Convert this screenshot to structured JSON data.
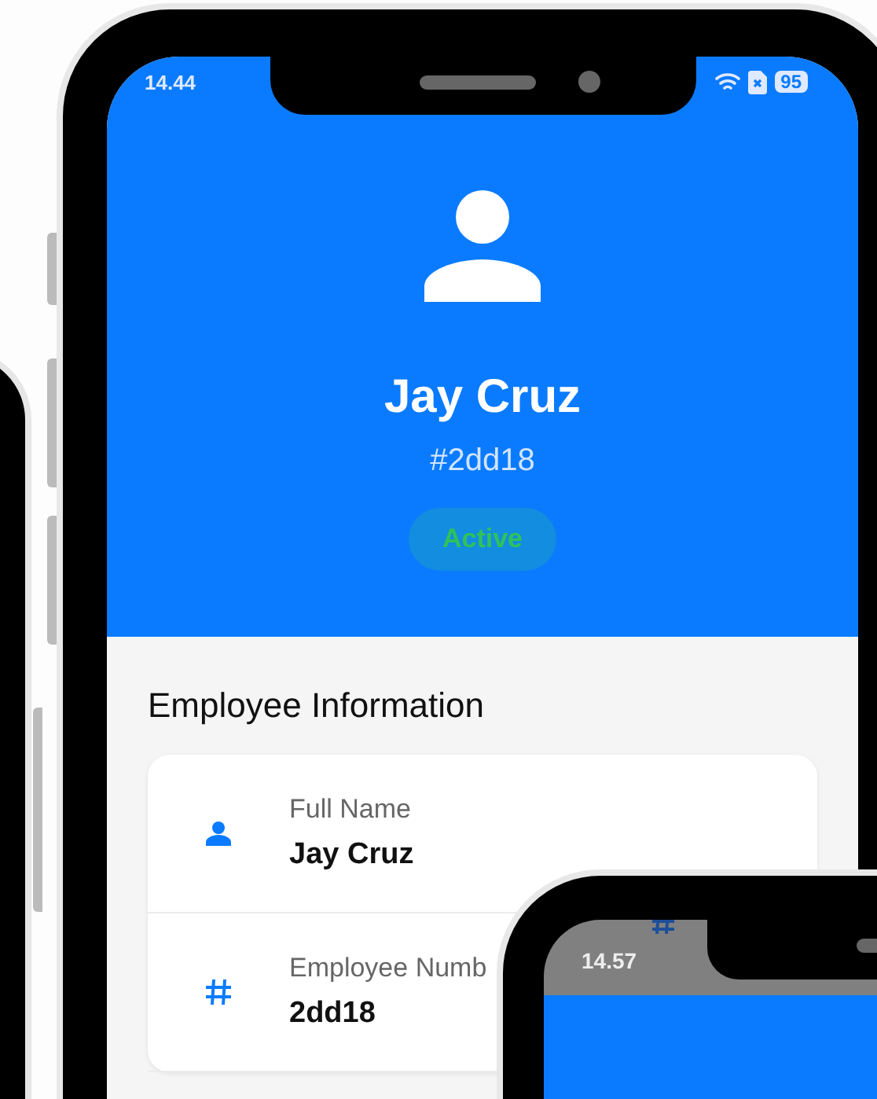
{
  "main_phone": {
    "status_bar": {
      "time": "14.44",
      "battery": "95"
    },
    "profile": {
      "name": "Jay Cruz",
      "id": "#2dd18",
      "status": {
        "label": "Active",
        "kind": "active"
      }
    },
    "section_title": "Employee Information",
    "fields": [
      {
        "kind": "person",
        "label": "Full Name",
        "value": "Jay Cruz"
      },
      {
        "kind": "hash",
        "label": "Employee Numb",
        "value": "2dd18"
      }
    ]
  },
  "second_phone": {
    "status_bar": {
      "time": "14.57"
    }
  }
}
